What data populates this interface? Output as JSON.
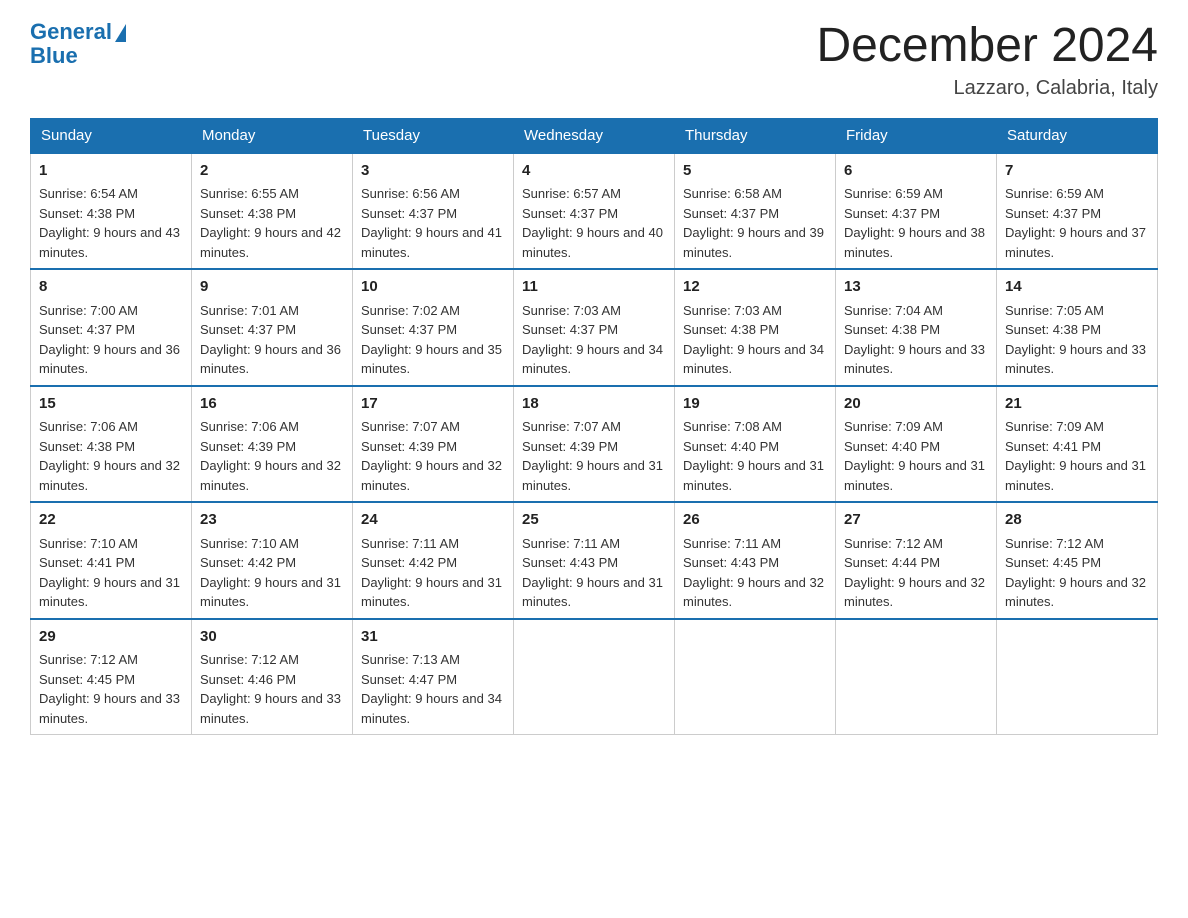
{
  "header": {
    "logo_text_general": "General",
    "logo_text_blue": "Blue",
    "month_title": "December 2024",
    "location": "Lazzaro, Calabria, Italy"
  },
  "days_of_week": [
    "Sunday",
    "Monday",
    "Tuesday",
    "Wednesday",
    "Thursday",
    "Friday",
    "Saturday"
  ],
  "weeks": [
    [
      {
        "day": "1",
        "sunrise": "6:54 AM",
        "sunset": "4:38 PM",
        "daylight": "9 hours and 43 minutes."
      },
      {
        "day": "2",
        "sunrise": "6:55 AM",
        "sunset": "4:38 PM",
        "daylight": "9 hours and 42 minutes."
      },
      {
        "day": "3",
        "sunrise": "6:56 AM",
        "sunset": "4:37 PM",
        "daylight": "9 hours and 41 minutes."
      },
      {
        "day": "4",
        "sunrise": "6:57 AM",
        "sunset": "4:37 PM",
        "daylight": "9 hours and 40 minutes."
      },
      {
        "day": "5",
        "sunrise": "6:58 AM",
        "sunset": "4:37 PM",
        "daylight": "9 hours and 39 minutes."
      },
      {
        "day": "6",
        "sunrise": "6:59 AM",
        "sunset": "4:37 PM",
        "daylight": "9 hours and 38 minutes."
      },
      {
        "day": "7",
        "sunrise": "6:59 AM",
        "sunset": "4:37 PM",
        "daylight": "9 hours and 37 minutes."
      }
    ],
    [
      {
        "day": "8",
        "sunrise": "7:00 AM",
        "sunset": "4:37 PM",
        "daylight": "9 hours and 36 minutes."
      },
      {
        "day": "9",
        "sunrise": "7:01 AM",
        "sunset": "4:37 PM",
        "daylight": "9 hours and 36 minutes."
      },
      {
        "day": "10",
        "sunrise": "7:02 AM",
        "sunset": "4:37 PM",
        "daylight": "9 hours and 35 minutes."
      },
      {
        "day": "11",
        "sunrise": "7:03 AM",
        "sunset": "4:37 PM",
        "daylight": "9 hours and 34 minutes."
      },
      {
        "day": "12",
        "sunrise": "7:03 AM",
        "sunset": "4:38 PM",
        "daylight": "9 hours and 34 minutes."
      },
      {
        "day": "13",
        "sunrise": "7:04 AM",
        "sunset": "4:38 PM",
        "daylight": "9 hours and 33 minutes."
      },
      {
        "day": "14",
        "sunrise": "7:05 AM",
        "sunset": "4:38 PM",
        "daylight": "9 hours and 33 minutes."
      }
    ],
    [
      {
        "day": "15",
        "sunrise": "7:06 AM",
        "sunset": "4:38 PM",
        "daylight": "9 hours and 32 minutes."
      },
      {
        "day": "16",
        "sunrise": "7:06 AM",
        "sunset": "4:39 PM",
        "daylight": "9 hours and 32 minutes."
      },
      {
        "day": "17",
        "sunrise": "7:07 AM",
        "sunset": "4:39 PM",
        "daylight": "9 hours and 32 minutes."
      },
      {
        "day": "18",
        "sunrise": "7:07 AM",
        "sunset": "4:39 PM",
        "daylight": "9 hours and 31 minutes."
      },
      {
        "day": "19",
        "sunrise": "7:08 AM",
        "sunset": "4:40 PM",
        "daylight": "9 hours and 31 minutes."
      },
      {
        "day": "20",
        "sunrise": "7:09 AM",
        "sunset": "4:40 PM",
        "daylight": "9 hours and 31 minutes."
      },
      {
        "day": "21",
        "sunrise": "7:09 AM",
        "sunset": "4:41 PM",
        "daylight": "9 hours and 31 minutes."
      }
    ],
    [
      {
        "day": "22",
        "sunrise": "7:10 AM",
        "sunset": "4:41 PM",
        "daylight": "9 hours and 31 minutes."
      },
      {
        "day": "23",
        "sunrise": "7:10 AM",
        "sunset": "4:42 PM",
        "daylight": "9 hours and 31 minutes."
      },
      {
        "day": "24",
        "sunrise": "7:11 AM",
        "sunset": "4:42 PM",
        "daylight": "9 hours and 31 minutes."
      },
      {
        "day": "25",
        "sunrise": "7:11 AM",
        "sunset": "4:43 PM",
        "daylight": "9 hours and 31 minutes."
      },
      {
        "day": "26",
        "sunrise": "7:11 AM",
        "sunset": "4:43 PM",
        "daylight": "9 hours and 32 minutes."
      },
      {
        "day": "27",
        "sunrise": "7:12 AM",
        "sunset": "4:44 PM",
        "daylight": "9 hours and 32 minutes."
      },
      {
        "day": "28",
        "sunrise": "7:12 AM",
        "sunset": "4:45 PM",
        "daylight": "9 hours and 32 minutes."
      }
    ],
    [
      {
        "day": "29",
        "sunrise": "7:12 AM",
        "sunset": "4:45 PM",
        "daylight": "9 hours and 33 minutes."
      },
      {
        "day": "30",
        "sunrise": "7:12 AM",
        "sunset": "4:46 PM",
        "daylight": "9 hours and 33 minutes."
      },
      {
        "day": "31",
        "sunrise": "7:13 AM",
        "sunset": "4:47 PM",
        "daylight": "9 hours and 34 minutes."
      },
      null,
      null,
      null,
      null
    ]
  ]
}
